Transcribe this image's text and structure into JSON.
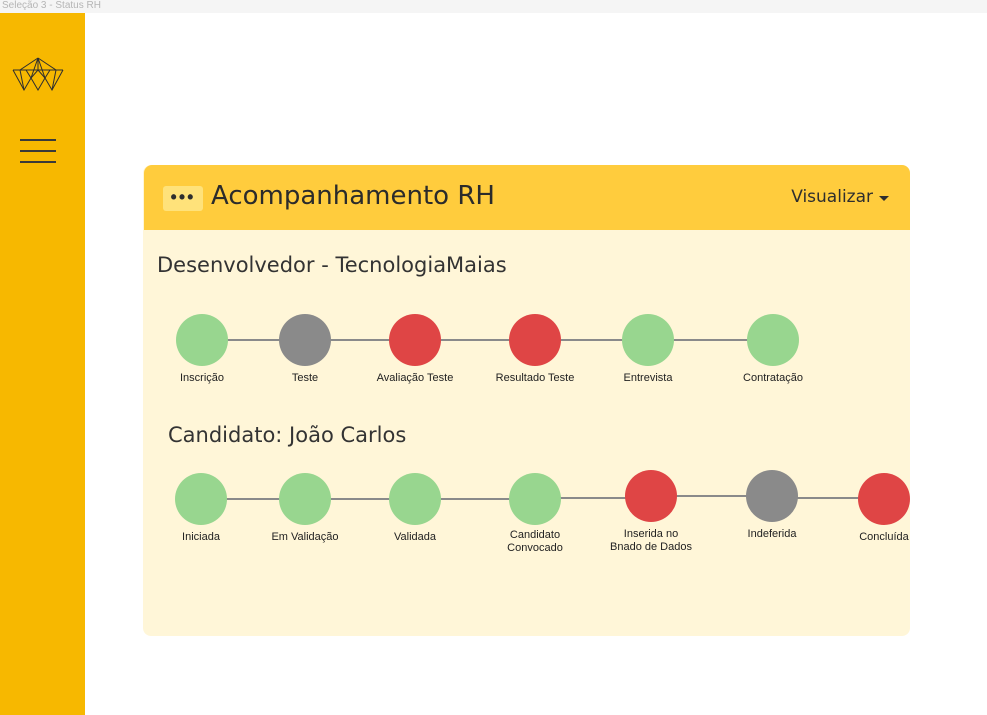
{
  "frame_label": "Seleção 3 - Status RH",
  "sidebar": {
    "logo_icon": "crystal-logo-icon",
    "menu_icon": "hamburger-menu-icon",
    "color": "#f7b800"
  },
  "card": {
    "title": "Acompanhamento RH",
    "dots_label": "•••",
    "view_label": "Visualizar",
    "header_color": "#ffcc3d",
    "body_color": "#fff6d8"
  },
  "job": {
    "title": "Desenvolvedor - TecnologiaMaias",
    "steps": [
      {
        "label": "Inscrição",
        "status": "done"
      },
      {
        "label": "Teste",
        "status": "pending"
      },
      {
        "label": "Avaliação Teste",
        "status": "failed"
      },
      {
        "label": "Resultado Teste",
        "status": "failed"
      },
      {
        "label": "Entrevista",
        "status": "done"
      },
      {
        "label": "Contratação",
        "status": "done"
      }
    ]
  },
  "candidate": {
    "title": "Candidato: João Carlos",
    "steps": [
      {
        "label": "Iniciada",
        "status": "done"
      },
      {
        "label": "Em Validação",
        "status": "done"
      },
      {
        "label": "Validada",
        "status": "done"
      },
      {
        "label": "Candidato\nConvocado",
        "status": "done"
      },
      {
        "label": "Inserida no\nBnado de Dados",
        "status": "failed"
      },
      {
        "label": "Indeferida",
        "status": "pending"
      },
      {
        "label": "Concluída",
        "status": "failed"
      }
    ]
  },
  "status_colors": {
    "done": "#98d68f",
    "pending": "#8a8a8a",
    "failed": "#df4545"
  }
}
